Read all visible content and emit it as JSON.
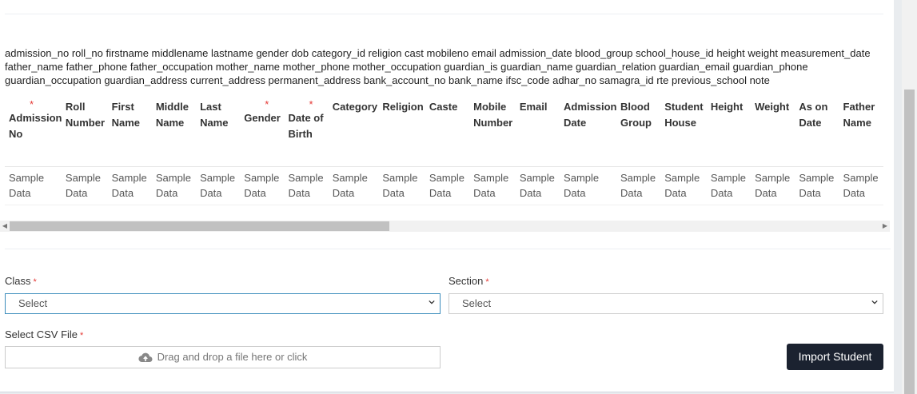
{
  "fields_text": "admission_no roll_no firstname middlename lastname gender dob category_id religion cast mobileno email admission_date blood_group school_house_id height weight measurement_date father_name father_phone father_occupation mother_name mother_phone mother_occupation guardian_is guardian_name guardian_relation guardian_email guardian_phone guardian_occupation guardian_address current_address permanent_address bank_account_no bank_name ifsc_code adhar_no samagra_id rte previous_school note",
  "required_mark": "*",
  "columns": [
    {
      "label": "Admission No",
      "required": true,
      "width": 74
    },
    {
      "label": "Roll Number",
      "required": false,
      "width": 58
    },
    {
      "label": "First Name",
      "required": false,
      "width": 55
    },
    {
      "label": "Middle Name",
      "required": false,
      "width": 55
    },
    {
      "label": "Last Name",
      "required": false,
      "width": 55
    },
    {
      "label": "Gender",
      "required": true,
      "width": 55
    },
    {
      "label": "Date of Birth",
      "required": true,
      "width": 55
    },
    {
      "label": "Category",
      "required": false,
      "width": 64
    },
    {
      "label": "Religion",
      "required": false,
      "width": 59
    },
    {
      "label": "Caste",
      "required": false,
      "width": 55
    },
    {
      "label": "Mobile Number",
      "required": false,
      "width": 58
    },
    {
      "label": "Email",
      "required": false,
      "width": 55
    },
    {
      "label": "Admission Date",
      "required": false,
      "width": 74
    },
    {
      "label": "Blood Group",
      "required": false,
      "width": 55
    },
    {
      "label": "Student House",
      "required": false,
      "width": 58
    },
    {
      "label": "Height",
      "required": false,
      "width": 55
    },
    {
      "label": "Weight",
      "required": false,
      "width": 55
    },
    {
      "label": "As on Date",
      "required": false,
      "width": 55
    },
    {
      "label": "Father Name",
      "required": false,
      "width": 55
    }
  ],
  "sample_value": "Sample Data",
  "class_label": "Class",
  "class_value": "Select",
  "section_label": "Section",
  "section_value": "Select",
  "csv_label": "Select CSV File",
  "dropzone_text": "Drag and drop a file here or click",
  "import_button": "Import Student",
  "icons": {
    "upload": "cloud-upload-icon",
    "chevron": "chevron-down-icon"
  }
}
